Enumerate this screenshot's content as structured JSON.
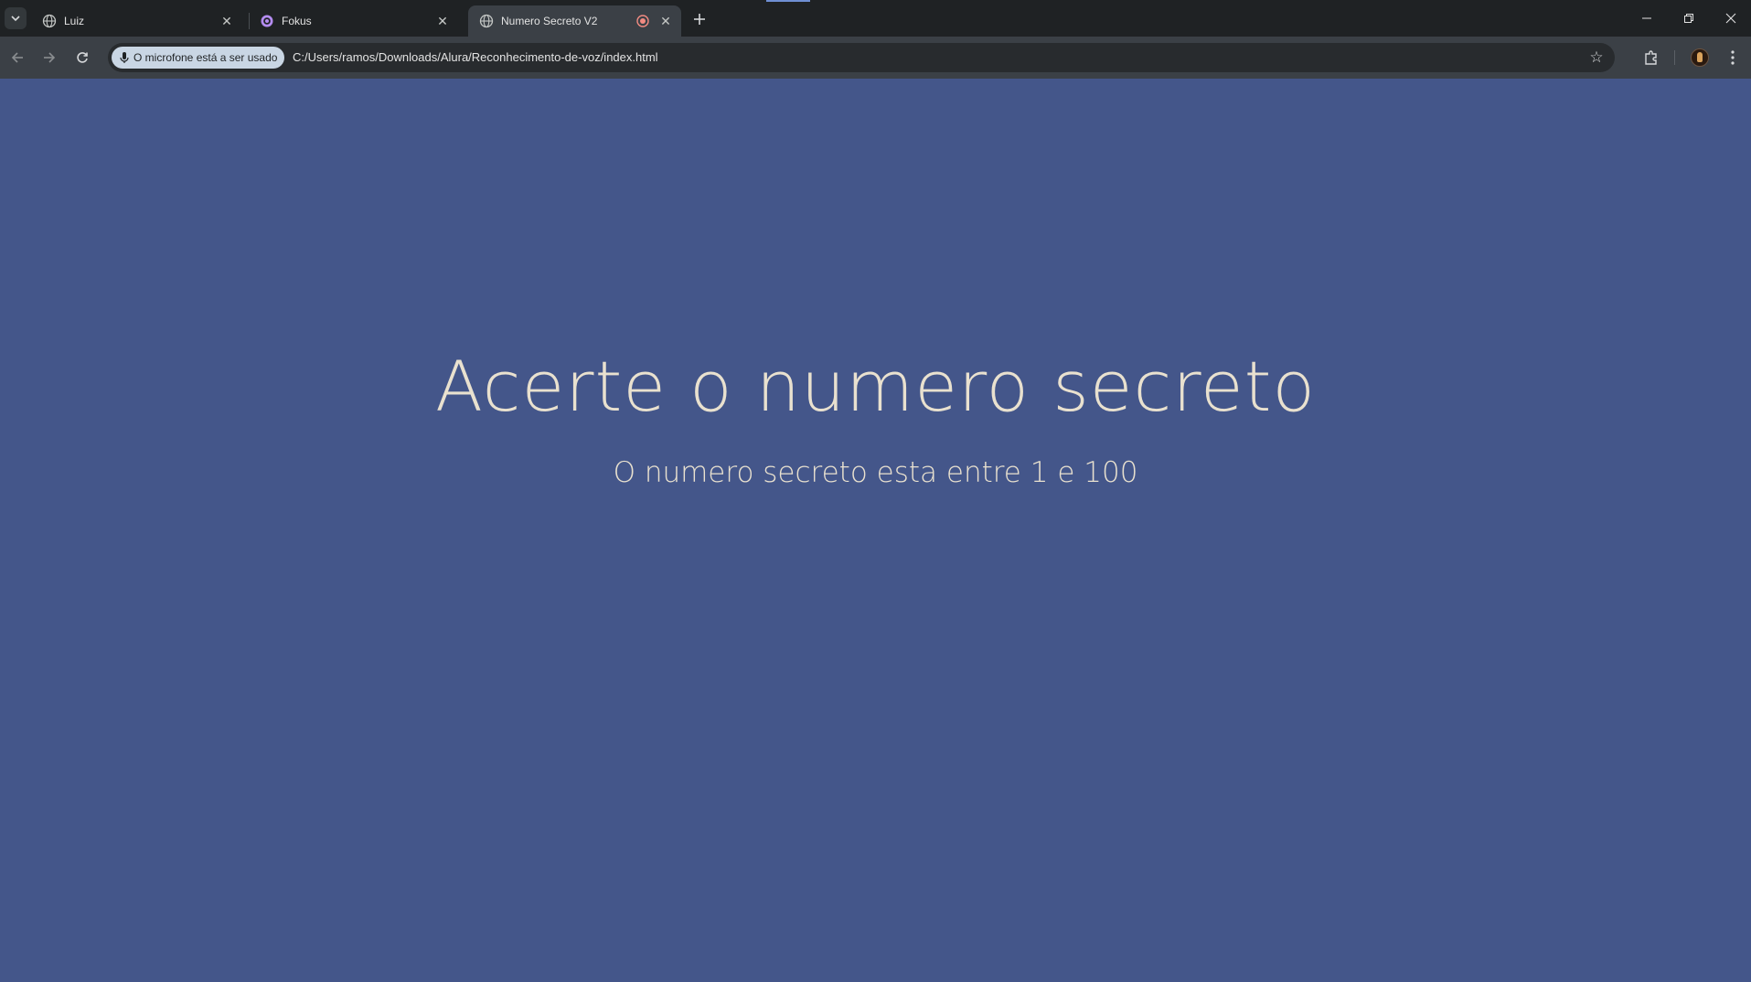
{
  "tabs": [
    {
      "title": "Luiz",
      "active": false,
      "favicon": "globe-icon"
    },
    {
      "title": "Fokus",
      "active": false,
      "favicon": "fokus-logo-icon"
    },
    {
      "title": "Numero Secreto V2",
      "active": true,
      "favicon": "globe-icon",
      "recording": true
    }
  ],
  "toolbar": {
    "mic_chip_label": "O microfone está a ser usado",
    "url": "C:/Users/ramos/Downloads/Alura/Reconhecimento-de-voz/index.html"
  },
  "page": {
    "title": "Acerte o numero secreto",
    "subtitle": "O numero secreto esta entre 1 e 100"
  },
  "colors": {
    "page_background": "#44568a",
    "page_text": "#e9e1cf",
    "tabstrip_background": "#1f2224",
    "toolbar_background": "#3b4046",
    "mic_chip_background": "#c9d6e4",
    "recording_indicator": "#f28b82"
  }
}
